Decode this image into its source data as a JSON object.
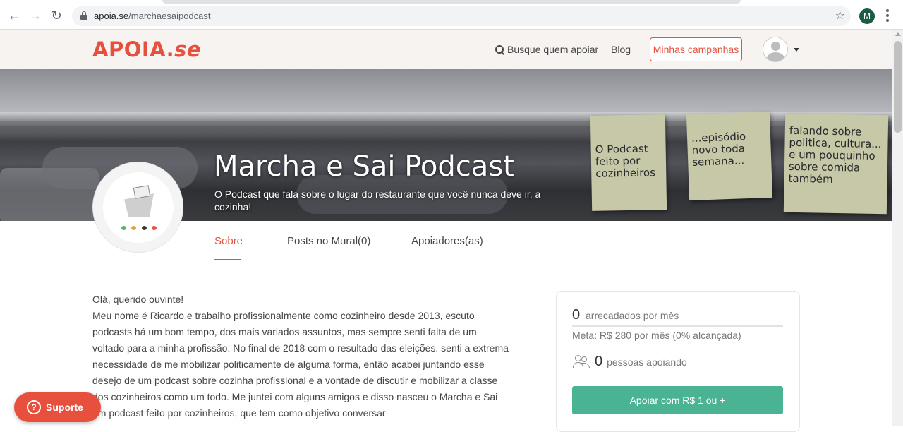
{
  "browser": {
    "url_host": "apoia.se",
    "url_path": "/marchaesaipodcast",
    "back_icon": "arrow-left-icon",
    "forward_icon": "arrow-right-icon",
    "reload_icon": "reload-icon",
    "star_icon": "star-icon",
    "profile_initial": "M",
    "profile_color": "#1e5b45"
  },
  "header": {
    "logo": "APOIA.se",
    "logo_main": "APOIA.",
    "logo_suffix": "se",
    "search_label": "Busque quem apoiar",
    "blog_label": "Blog",
    "campaigns_label": "Minhas campanhas",
    "brand_color": "#e8503e"
  },
  "banner": {
    "title": "Marcha e Sai Podcast",
    "subtitle": "O Podcast que fala sobre o lugar do restaurante que você nunca deve ir, a cozinha!",
    "notes": [
      "O Podcast feito por cozinheiros",
      "...episódio novo toda semana...",
      "falando sobre politica, cultura... e um pouquinho sobre comida também"
    ]
  },
  "tabs": [
    {
      "label": "Sobre",
      "active": true
    },
    {
      "label": "Posts no Mural(0)",
      "active": false
    },
    {
      "label": "Apoiadores(as)",
      "active": false
    }
  ],
  "about": {
    "greeting": "Olá, querido ouvinte!",
    "body": "Meu nome é Ricardo e trabalho profissionalmente como cozinheiro desde 2013, escuto podcasts há um bom tempo, dos mais variados assuntos, mas sempre senti falta de um voltado para a minha profissão. No final de 2018 com o resultado das eleições. senti a extrema necessidade de me mobilizar politicamente de alguma forma, então acabei juntando esse desejo de um podcast sobre cozinha profissional e a vontade de discutir e mobilizar a classe dos cozinheiros como um todo. Me juntei com alguns amigos e disso nasceu o Marcha e Sai um podcast feito por cozinheiros, que tem como objetivo  conversar"
  },
  "support_card": {
    "raised_value": "0",
    "raised_label": "arrecadados por mês",
    "goal_text": "Meta: R$ 280 por mês (0% alcançada)",
    "progress_percent": 0,
    "supporters_value": "0",
    "supporters_label": "pessoas apoiando",
    "button_label": "Apoiar com R$ 1 ou +",
    "accent_color": "#4ab393"
  },
  "help": {
    "label": "Suporte",
    "icon": "question-circle-icon"
  }
}
